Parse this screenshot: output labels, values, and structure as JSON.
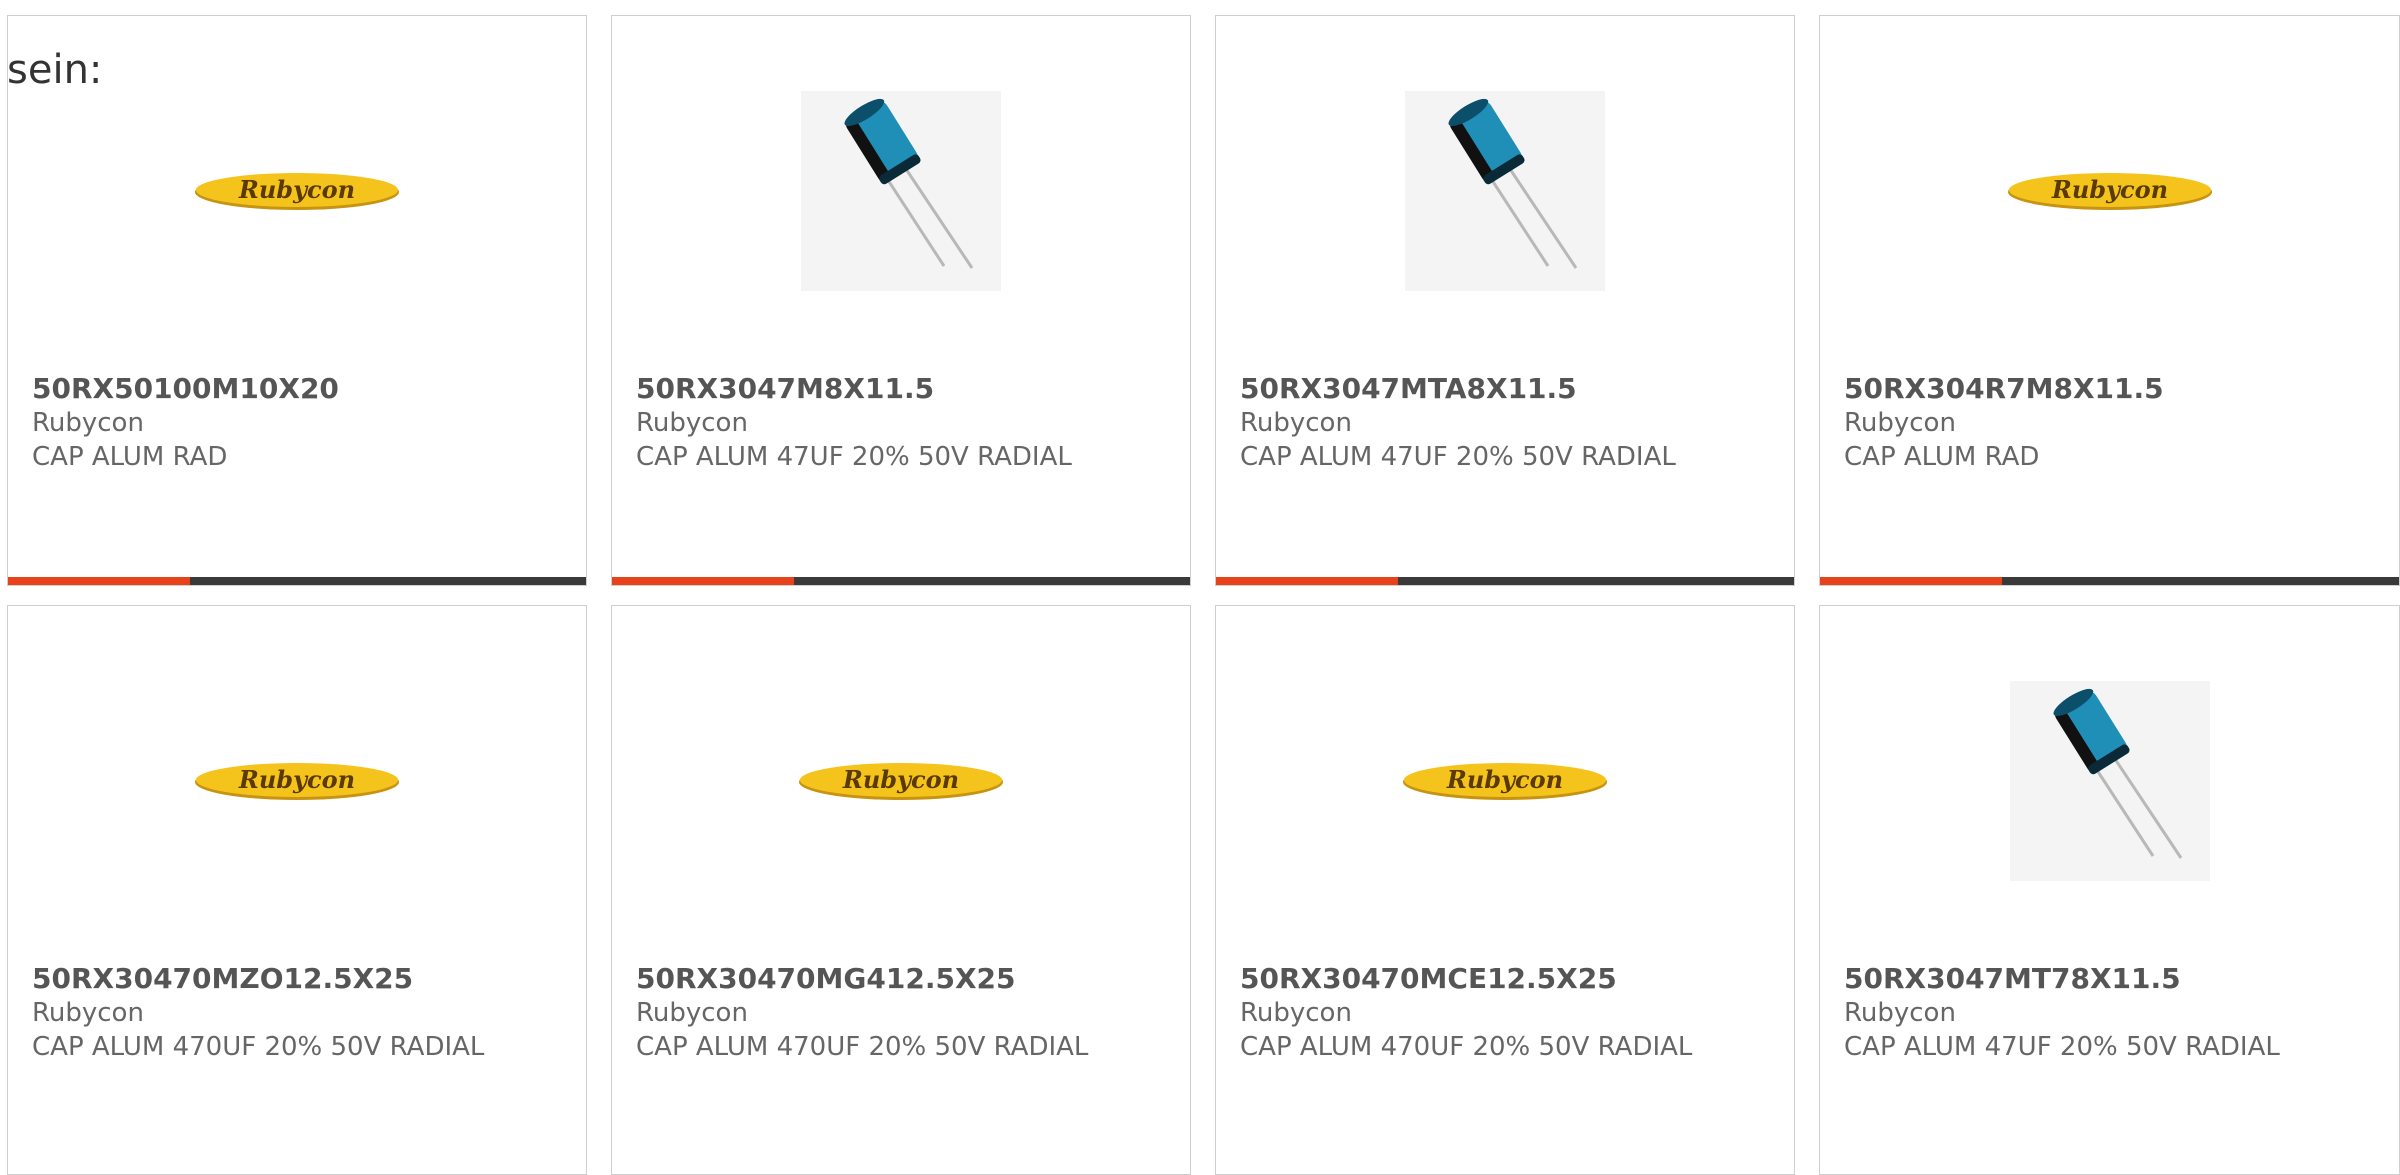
{
  "intro_text": "sein:",
  "colors": {
    "accent": "#e8421a",
    "bar": "#3a3a3a",
    "logo_yellow": "#f5c41c",
    "capacitor_blue": "#1f8fb8"
  },
  "products": [
    {
      "part_number": "50RX50100M10X20",
      "manufacturer": "Rubycon",
      "description": "CAP ALUM RAD",
      "image": "rubycon-logo"
    },
    {
      "part_number": "50RX3047M8X11.5",
      "manufacturer": "Rubycon",
      "description": "CAP ALUM 47UF 20% 50V RADIAL",
      "image": "capacitor-photo"
    },
    {
      "part_number": "50RX3047MTA8X11.5",
      "manufacturer": "Rubycon",
      "description": "CAP ALUM 47UF 20% 50V RADIAL",
      "image": "capacitor-photo"
    },
    {
      "part_number": "50RX304R7M8X11.5",
      "manufacturer": "Rubycon",
      "description": "CAP ALUM RAD",
      "image": "rubycon-logo"
    },
    {
      "part_number": "50RX30470MZO12.5X25",
      "manufacturer": "Rubycon",
      "description": "CAP ALUM 470UF 20% 50V RADIAL",
      "image": "rubycon-logo"
    },
    {
      "part_number": "50RX30470MG412.5X25",
      "manufacturer": "Rubycon",
      "description": "CAP ALUM 470UF 20% 50V RADIAL",
      "image": "rubycon-logo"
    },
    {
      "part_number": "50RX30470MCE12.5X25",
      "manufacturer": "Rubycon",
      "description": "CAP ALUM 470UF 20% 50V RADIAL",
      "image": "rubycon-logo"
    },
    {
      "part_number": "50RX3047MT78X11.5",
      "manufacturer": "Rubycon",
      "description": "CAP ALUM 47UF 20% 50V RADIAL",
      "image": "capacitor-photo"
    }
  ],
  "logo_text": "Rubycon"
}
